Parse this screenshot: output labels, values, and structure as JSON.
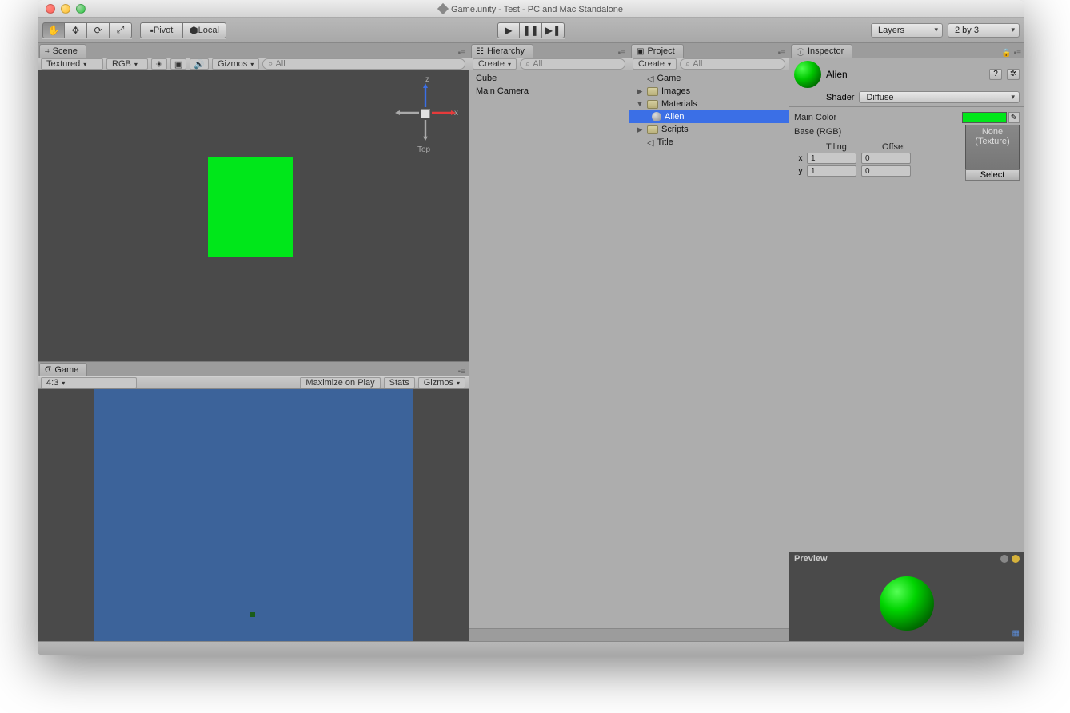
{
  "window": {
    "title": "Game.unity - Test - PC and Mac Standalone"
  },
  "toolbar": {
    "pivot": "Pivot",
    "local": "Local",
    "layers": "Layers",
    "layout": "2 by 3"
  },
  "scene": {
    "tab": "Scene",
    "shading": "Textured",
    "render": "RGB",
    "gizmos": "Gizmos",
    "search_ph": "All",
    "gizmo": {
      "top": "Top",
      "x": "x",
      "z": "z"
    }
  },
  "game": {
    "tab": "Game",
    "aspect": "4:3",
    "maximize": "Maximize on Play",
    "stats": "Stats",
    "gizmos": "Gizmos"
  },
  "hierarchy": {
    "tab": "Hierarchy",
    "create": "Create",
    "search_ph": "All",
    "items": [
      "Cube",
      "Main Camera"
    ]
  },
  "project": {
    "tab": "Project",
    "create": "Create",
    "search_ph": "All",
    "tree": {
      "game": "Game",
      "images": "Images",
      "materials": "Materials",
      "alien": "Alien",
      "scripts": "Scripts",
      "title": "Title"
    }
  },
  "inspector": {
    "tab": "Inspector",
    "material_name": "Alien",
    "shader_label": "Shader",
    "shader_value": "Diffuse",
    "main_color": "Main Color",
    "base_rgb": "Base (RGB)",
    "none_texture": "None (Texture)",
    "select": "Select",
    "tiling": "Tiling",
    "offset": "Offset",
    "x": "x",
    "y": "y",
    "tiling_x": "1",
    "tiling_y": "1",
    "offset_x": "0",
    "offset_y": "0",
    "preview": "Preview"
  }
}
